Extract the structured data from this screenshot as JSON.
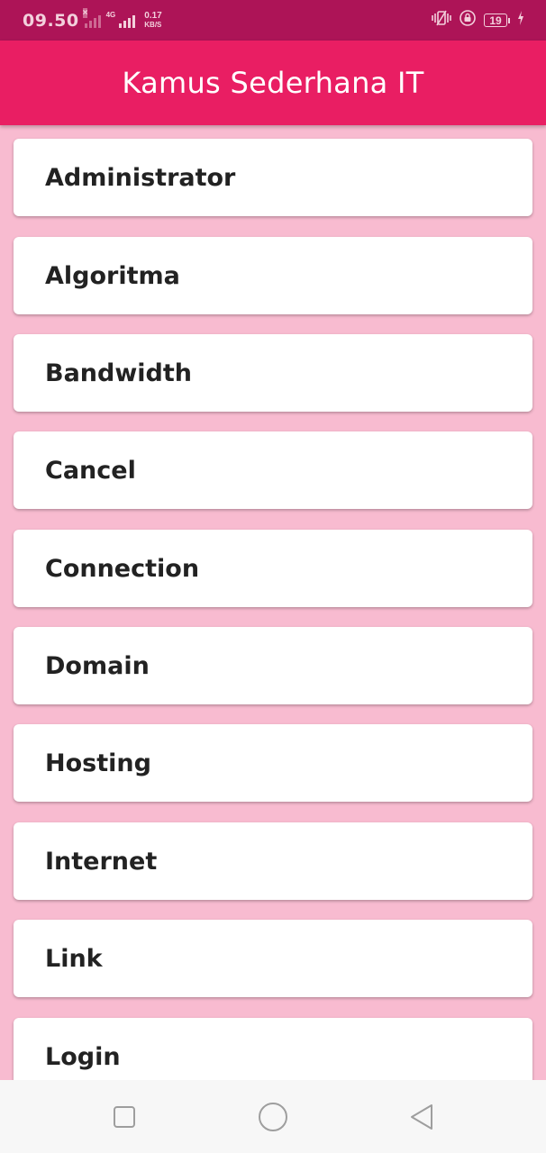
{
  "status_bar": {
    "time": "09.50",
    "network_type": "4G",
    "speed_value": "0.17",
    "speed_unit": "KB/S",
    "battery_level": "19",
    "icons": [
      "signal-icon",
      "signal-4g-icon",
      "vibrate-icon",
      "rotation-lock-icon",
      "battery-icon",
      "charging-icon"
    ]
  },
  "app_bar": {
    "title": "Kamus Sederhana IT",
    "color": "#e91e63"
  },
  "list": {
    "background": "#f8bbd0",
    "items": [
      {
        "label": "Administrator"
      },
      {
        "label": "Algoritma"
      },
      {
        "label": "Bandwidth"
      },
      {
        "label": "Cancel"
      },
      {
        "label": "Connection"
      },
      {
        "label": "Domain"
      },
      {
        "label": "Hosting"
      },
      {
        "label": "Internet"
      },
      {
        "label": "Link"
      },
      {
        "label": "Login"
      }
    ]
  },
  "nav_bar": {
    "buttons": [
      "recents-button",
      "home-button",
      "back-button"
    ]
  }
}
